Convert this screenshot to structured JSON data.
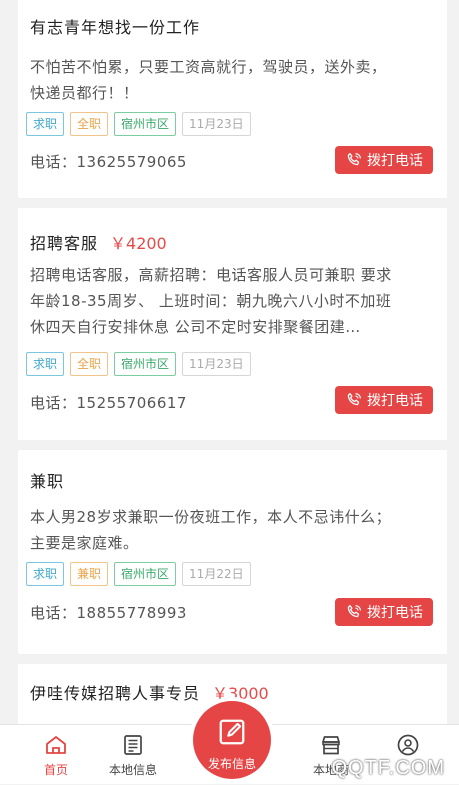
{
  "listings": [
    {
      "title": "有志青年想找一份工作",
      "price": "",
      "desc_lines": [
        "不怕苦不怕累，只要工资高就行，驾驶员，送外卖，",
        "快递员都行！！"
      ],
      "tags": {
        "type": "求职",
        "mode": "全职",
        "area": "宿州市区",
        "date": "11月23日"
      },
      "phone": "电话：13625579065",
      "call_label": "拨打电话"
    },
    {
      "title": "招聘客服",
      "price": "￥4200",
      "desc_lines": [
        "招聘电话客服，高薪招聘：电话客服人员可兼职 要求",
        "年龄18-35周岁、 上班时间：朝九晚六八小时不加班",
        "休四天自行安排休息 公司不定时安排聚餐团建…"
      ],
      "tags": {
        "type": "求职",
        "mode": "全职",
        "area": "宿州市区",
        "date": "11月23日"
      },
      "phone": "电话：15255706617",
      "call_label": "拨打电话"
    },
    {
      "title": "兼职",
      "price": "",
      "desc_lines": [
        "本人男28岁求兼职一份夜班工作，本人不忌讳什么；",
        "主要是家庭难。"
      ],
      "tags": {
        "type": "求职",
        "mode": "兼职",
        "area": "宿州市区",
        "date": "11月22日"
      },
      "phone": "电话：18855778993",
      "call_label": "拨打电话"
    },
    {
      "title": "伊哇传媒招聘人事专员",
      "price": "￥3000"
    }
  ],
  "tabbar": {
    "home": "首页",
    "local_info": "本地信息",
    "publish": "发布信息",
    "local_shop": "本地商",
    "profile": "我的"
  },
  "watermark": "QQTF.COM",
  "colors": {
    "accent": "#e64545",
    "price": "#e64a4a"
  }
}
